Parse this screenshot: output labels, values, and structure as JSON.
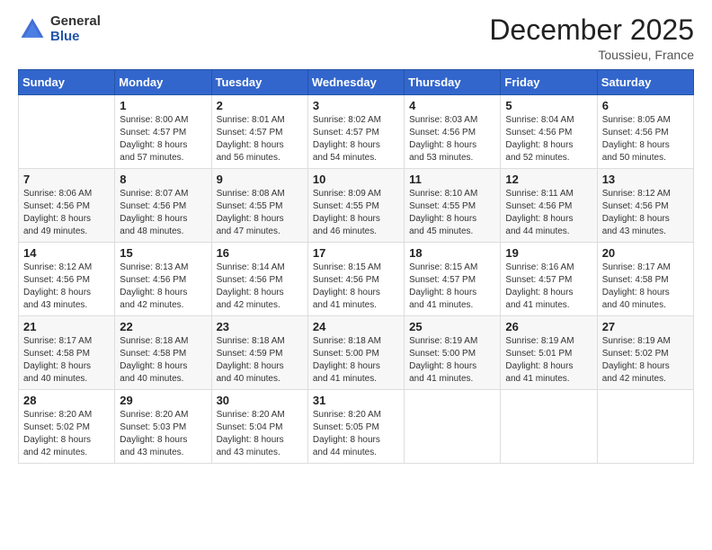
{
  "logo": {
    "general": "General",
    "blue": "Blue"
  },
  "header": {
    "month": "December 2025",
    "location": "Toussieu, France"
  },
  "days_of_week": [
    "Sunday",
    "Monday",
    "Tuesday",
    "Wednesday",
    "Thursday",
    "Friday",
    "Saturday"
  ],
  "weeks": [
    [
      {
        "day": "",
        "sunrise": "",
        "sunset": "",
        "daylight": ""
      },
      {
        "day": "1",
        "sunrise": "Sunrise: 8:00 AM",
        "sunset": "Sunset: 4:57 PM",
        "daylight": "Daylight: 8 hours and 57 minutes."
      },
      {
        "day": "2",
        "sunrise": "Sunrise: 8:01 AM",
        "sunset": "Sunset: 4:57 PM",
        "daylight": "Daylight: 8 hours and 56 minutes."
      },
      {
        "day": "3",
        "sunrise": "Sunrise: 8:02 AM",
        "sunset": "Sunset: 4:57 PM",
        "daylight": "Daylight: 8 hours and 54 minutes."
      },
      {
        "day": "4",
        "sunrise": "Sunrise: 8:03 AM",
        "sunset": "Sunset: 4:56 PM",
        "daylight": "Daylight: 8 hours and 53 minutes."
      },
      {
        "day": "5",
        "sunrise": "Sunrise: 8:04 AM",
        "sunset": "Sunset: 4:56 PM",
        "daylight": "Daylight: 8 hours and 52 minutes."
      },
      {
        "day": "6",
        "sunrise": "Sunrise: 8:05 AM",
        "sunset": "Sunset: 4:56 PM",
        "daylight": "Daylight: 8 hours and 50 minutes."
      }
    ],
    [
      {
        "day": "7",
        "sunrise": "Sunrise: 8:06 AM",
        "sunset": "Sunset: 4:56 PM",
        "daylight": "Daylight: 8 hours and 49 minutes."
      },
      {
        "day": "8",
        "sunrise": "Sunrise: 8:07 AM",
        "sunset": "Sunset: 4:56 PM",
        "daylight": "Daylight: 8 hours and 48 minutes."
      },
      {
        "day": "9",
        "sunrise": "Sunrise: 8:08 AM",
        "sunset": "Sunset: 4:55 PM",
        "daylight": "Daylight: 8 hours and 47 minutes."
      },
      {
        "day": "10",
        "sunrise": "Sunrise: 8:09 AM",
        "sunset": "Sunset: 4:55 PM",
        "daylight": "Daylight: 8 hours and 46 minutes."
      },
      {
        "day": "11",
        "sunrise": "Sunrise: 8:10 AM",
        "sunset": "Sunset: 4:55 PM",
        "daylight": "Daylight: 8 hours and 45 minutes."
      },
      {
        "day": "12",
        "sunrise": "Sunrise: 8:11 AM",
        "sunset": "Sunset: 4:56 PM",
        "daylight": "Daylight: 8 hours and 44 minutes."
      },
      {
        "day": "13",
        "sunrise": "Sunrise: 8:12 AM",
        "sunset": "Sunset: 4:56 PM",
        "daylight": "Daylight: 8 hours and 43 minutes."
      }
    ],
    [
      {
        "day": "14",
        "sunrise": "Sunrise: 8:12 AM",
        "sunset": "Sunset: 4:56 PM",
        "daylight": "Daylight: 8 hours and 43 minutes."
      },
      {
        "day": "15",
        "sunrise": "Sunrise: 8:13 AM",
        "sunset": "Sunset: 4:56 PM",
        "daylight": "Daylight: 8 hours and 42 minutes."
      },
      {
        "day": "16",
        "sunrise": "Sunrise: 8:14 AM",
        "sunset": "Sunset: 4:56 PM",
        "daylight": "Daylight: 8 hours and 42 minutes."
      },
      {
        "day": "17",
        "sunrise": "Sunrise: 8:15 AM",
        "sunset": "Sunset: 4:56 PM",
        "daylight": "Daylight: 8 hours and 41 minutes."
      },
      {
        "day": "18",
        "sunrise": "Sunrise: 8:15 AM",
        "sunset": "Sunset: 4:57 PM",
        "daylight": "Daylight: 8 hours and 41 minutes."
      },
      {
        "day": "19",
        "sunrise": "Sunrise: 8:16 AM",
        "sunset": "Sunset: 4:57 PM",
        "daylight": "Daylight: 8 hours and 41 minutes."
      },
      {
        "day": "20",
        "sunrise": "Sunrise: 8:17 AM",
        "sunset": "Sunset: 4:58 PM",
        "daylight": "Daylight: 8 hours and 40 minutes."
      }
    ],
    [
      {
        "day": "21",
        "sunrise": "Sunrise: 8:17 AM",
        "sunset": "Sunset: 4:58 PM",
        "daylight": "Daylight: 8 hours and 40 minutes."
      },
      {
        "day": "22",
        "sunrise": "Sunrise: 8:18 AM",
        "sunset": "Sunset: 4:58 PM",
        "daylight": "Daylight: 8 hours and 40 minutes."
      },
      {
        "day": "23",
        "sunrise": "Sunrise: 8:18 AM",
        "sunset": "Sunset: 4:59 PM",
        "daylight": "Daylight: 8 hours and 40 minutes."
      },
      {
        "day": "24",
        "sunrise": "Sunrise: 8:18 AM",
        "sunset": "Sunset: 5:00 PM",
        "daylight": "Daylight: 8 hours and 41 minutes."
      },
      {
        "day": "25",
        "sunrise": "Sunrise: 8:19 AM",
        "sunset": "Sunset: 5:00 PM",
        "daylight": "Daylight: 8 hours and 41 minutes."
      },
      {
        "day": "26",
        "sunrise": "Sunrise: 8:19 AM",
        "sunset": "Sunset: 5:01 PM",
        "daylight": "Daylight: 8 hours and 41 minutes."
      },
      {
        "day": "27",
        "sunrise": "Sunrise: 8:19 AM",
        "sunset": "Sunset: 5:02 PM",
        "daylight": "Daylight: 8 hours and 42 minutes."
      }
    ],
    [
      {
        "day": "28",
        "sunrise": "Sunrise: 8:20 AM",
        "sunset": "Sunset: 5:02 PM",
        "daylight": "Daylight: 8 hours and 42 minutes."
      },
      {
        "day": "29",
        "sunrise": "Sunrise: 8:20 AM",
        "sunset": "Sunset: 5:03 PM",
        "daylight": "Daylight: 8 hours and 43 minutes."
      },
      {
        "day": "30",
        "sunrise": "Sunrise: 8:20 AM",
        "sunset": "Sunset: 5:04 PM",
        "daylight": "Daylight: 8 hours and 43 minutes."
      },
      {
        "day": "31",
        "sunrise": "Sunrise: 8:20 AM",
        "sunset": "Sunset: 5:05 PM",
        "daylight": "Daylight: 8 hours and 44 minutes."
      },
      {
        "day": "",
        "sunrise": "",
        "sunset": "",
        "daylight": ""
      },
      {
        "day": "",
        "sunrise": "",
        "sunset": "",
        "daylight": ""
      },
      {
        "day": "",
        "sunrise": "",
        "sunset": "",
        "daylight": ""
      }
    ]
  ]
}
